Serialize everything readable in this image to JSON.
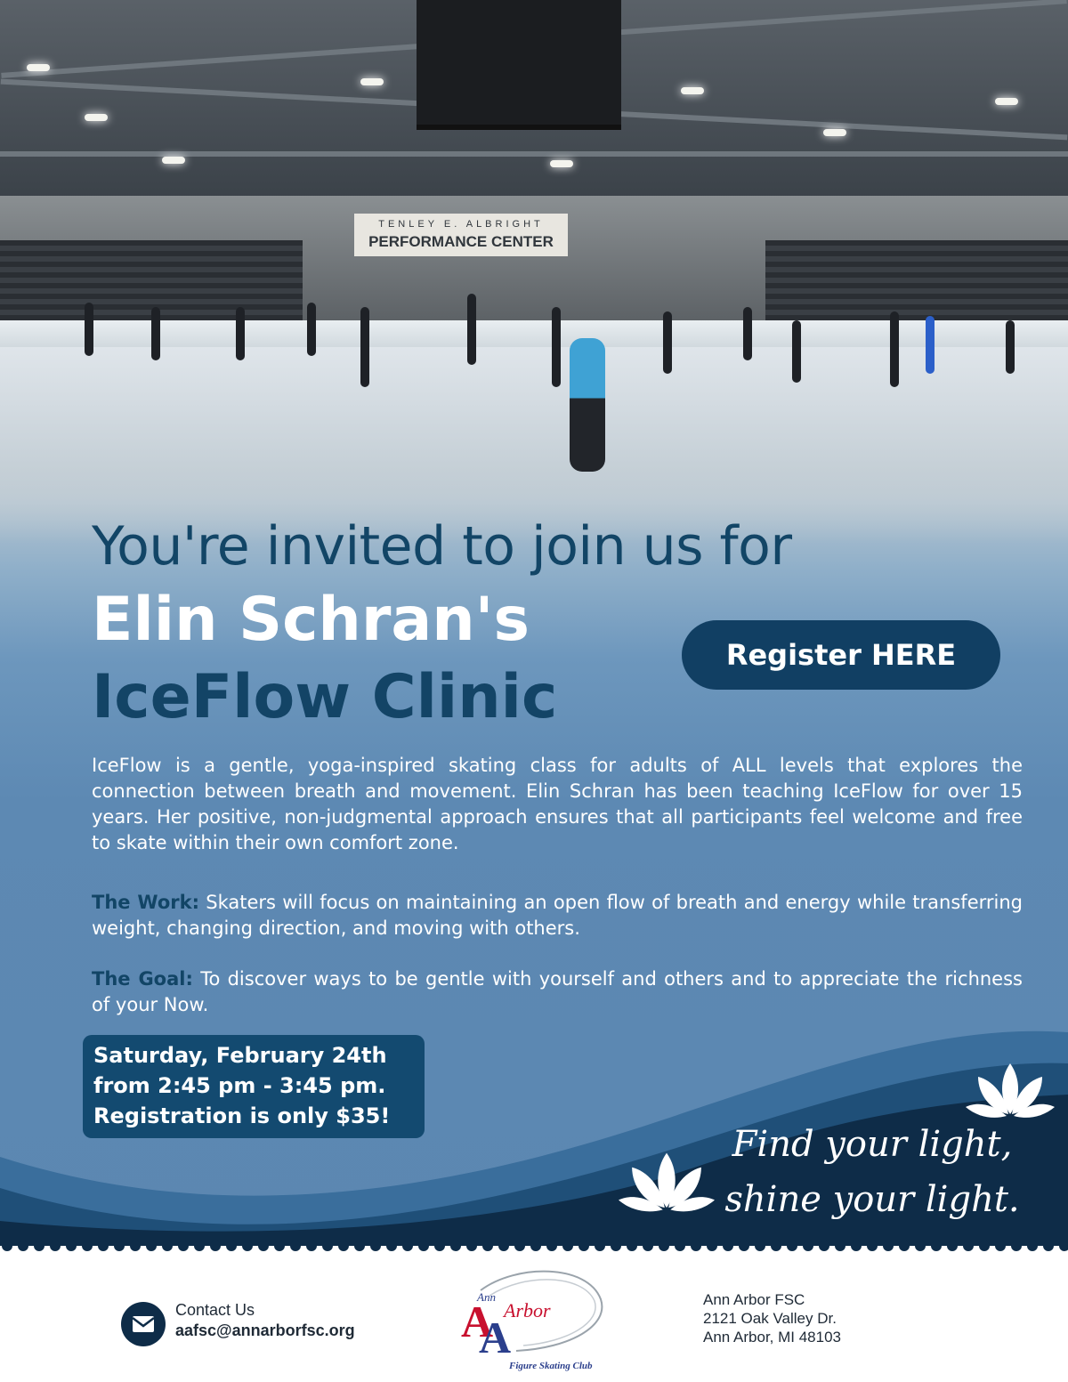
{
  "event": {
    "invite_line": "You're invited to join us for",
    "name_line": "Elin Schran's",
    "clinic_line": "IceFlow Clinic",
    "register_label": "Register HERE",
    "description": "IceFlow is a gentle, yoga-inspired skating class for adults of ALL levels that explores the connection between breath and movement. Elin Schran has been teaching IceFlow for over 15 years. Her positive, non-judgmental approach ensures that all participants feel welcome and free to skate within their own comfort zone.",
    "work_label": "The Work:",
    "work_text": "Skaters will focus on maintaining an open flow of breath and energy while transferring weight, changing direction, and moving with others.",
    "goal_label": "The Goal:",
    "goal_text": "To discover ways to be gentle with yourself and others and to appreciate the richness of your Now.",
    "date_line": "Saturday, February 24th",
    "time_line": "from 2:45 pm - 3:45 pm.",
    "price_line": "Registration is only $35!",
    "tagline_1": "Find your light,",
    "tagline_2": "shine your light."
  },
  "photo": {
    "banner_small": "TENLEY E. ALBRIGHT",
    "banner_main": "PERFORMANCE CENTER"
  },
  "footer": {
    "contact_label": "Contact Us",
    "contact_email": "aafsc@annarborfsc.org",
    "logo_ann": "Ann",
    "logo_arbor": "Arbor",
    "logo_caption": "Figure Skating Club",
    "address_name": "Ann Arbor FSC",
    "address_street": "2121 Oak Valley Dr.",
    "address_city": "Ann Arbor, MI 48103"
  },
  "colors": {
    "navy": "#0e2c48",
    "dark_blue": "#124566",
    "mid_blue": "#5c87b1",
    "button_blue": "#113f63"
  },
  "icons": [
    "mail-icon",
    "lotus-icon"
  ]
}
